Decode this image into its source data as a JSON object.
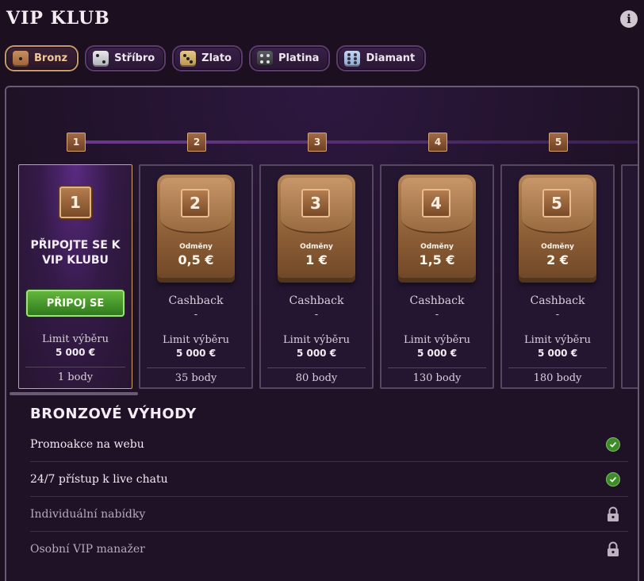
{
  "header": {
    "title": "VIP KLUB",
    "info_icon": "info-icon"
  },
  "tiers": [
    {
      "label": "Bronz",
      "icon": "bronze-die-icon",
      "active": true
    },
    {
      "label": "Stříbro",
      "icon": "silver-die-icon",
      "active": false
    },
    {
      "label": "Zlato",
      "icon": "gold-die-icon",
      "active": false
    },
    {
      "label": "Platina",
      "icon": "platinum-die-icon",
      "active": false
    },
    {
      "label": "Diamant",
      "icon": "diamond-die-icon",
      "active": false
    }
  ],
  "levels": [
    "1",
    "2",
    "3",
    "4",
    "5"
  ],
  "cards": [
    {
      "level": "1",
      "headline": "PŘIPOJTE SE K VIP KLUBU",
      "button": "PŘIPOJ SE",
      "limit_label": "Limit výběru",
      "limit_value": "5 000 €",
      "points": "1 body"
    },
    {
      "level": "2",
      "reward_label": "Odměny",
      "reward_value": "0,5 €",
      "cashback_label": "Cashback",
      "cashback_value": "-",
      "limit_label": "Limit výběru",
      "limit_value": "5 000 €",
      "points": "35 body"
    },
    {
      "level": "3",
      "reward_label": "Odměny",
      "reward_value": "1 €",
      "cashback_label": "Cashback",
      "cashback_value": "-",
      "limit_label": "Limit výběru",
      "limit_value": "5 000 €",
      "points": "80 body"
    },
    {
      "level": "4",
      "reward_label": "Odměny",
      "reward_value": "1,5 €",
      "cashback_label": "Cashback",
      "cashback_value": "-",
      "limit_label": "Limit výběru",
      "limit_value": "5 000 €",
      "points": "130 body"
    },
    {
      "level": "5",
      "reward_label": "Odměny",
      "reward_value": "2 €",
      "cashback_label": "Cashback",
      "cashback_value": "-",
      "limit_label": "Limit výběru",
      "limit_value": "5 000 €",
      "points": "180 body"
    }
  ],
  "benefits": {
    "title": "BRONZOVÉ VÝHODY",
    "items": [
      {
        "label": "Promoakce na webu",
        "status": "check-icon"
      },
      {
        "label": "24/7 přístup k live chatu",
        "status": "check-icon"
      },
      {
        "label": "Individuální nabídky",
        "status": "lock-icon"
      },
      {
        "label": "Osobní VIP manažer",
        "status": "lock-icon"
      }
    ]
  },
  "colors": {
    "background": "#1c1020",
    "accent_bronze": "#c49a6a",
    "join_button": "#4a9a2e",
    "check": "#3f8a2c"
  }
}
